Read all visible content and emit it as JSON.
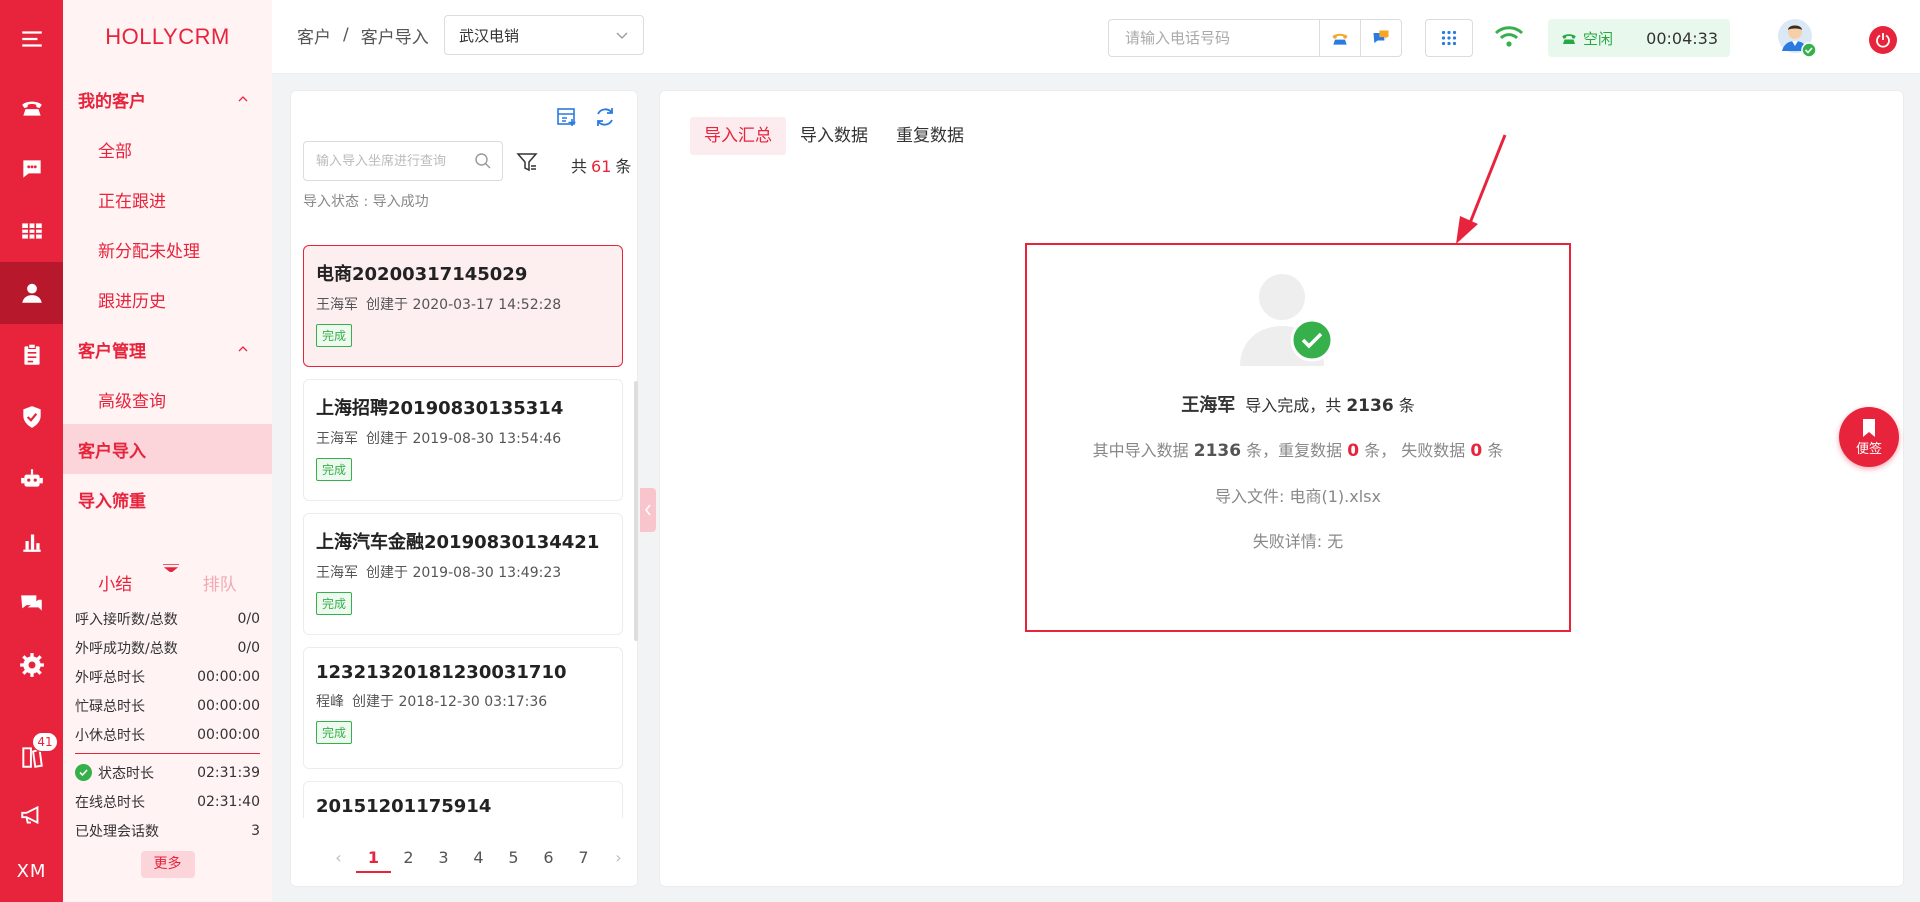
{
  "brand": "HOLLYCRM",
  "rail": {
    "badge": "41",
    "xm": "XM"
  },
  "sidebar": {
    "group1": "我的客户",
    "group1_items": [
      "全部",
      "正在跟进",
      "新分配未处理",
      "跟进历史"
    ],
    "group2": "客户管理",
    "group2_items": [
      "高级查询"
    ],
    "import": "客户导入",
    "filter": "导入筛重"
  },
  "stats": {
    "tab_summary": "小结",
    "tab_queue": "排队",
    "rows": [
      {
        "label": "呼入接听数/总数",
        "value": "0/0"
      },
      {
        "label": "外呼成功数/总数",
        "value": "0/0"
      },
      {
        "label": "外呼总时长",
        "value": "00:00:00"
      },
      {
        "label": "忙碌总时长",
        "value": "00:00:00"
      },
      {
        "label": "小休总时长",
        "value": "00:00:00"
      }
    ],
    "rows2": [
      {
        "label": "状态时长",
        "value": "02:31:39"
      },
      {
        "label": "在线总时长",
        "value": "02:31:40"
      },
      {
        "label": "已处理会话数",
        "value": "3"
      }
    ],
    "more": "更多"
  },
  "topbar": {
    "crumb1": "客户",
    "sep": "/",
    "crumb2": "客户导入",
    "select_value": "武汉电销",
    "phone_placeholder": "请输入电话号码",
    "status": "空闲",
    "timer": "00:04:33"
  },
  "list": {
    "search_placeholder": "输入导入坐席进行查询",
    "count_prefix": "共",
    "count": "61",
    "count_suffix": "条",
    "status_line": "导入状态 : 导入成功",
    "cards": [
      {
        "title": "电商20200317145029",
        "who": "王海军",
        "created": "创建于 2020-03-17 14:52:28",
        "tag": "完成"
      },
      {
        "title": "上海招聘20190830135314",
        "who": "王海军",
        "created": "创建于 2019-08-30 13:54:46",
        "tag": "完成"
      },
      {
        "title": "上海汽车金融20190830134421",
        "who": "王海军",
        "created": "创建于 2019-08-30 13:49:23",
        "tag": "完成"
      },
      {
        "title": "12321320181230031710",
        "who": "程峰",
        "created": "创建于 2018-12-30 03:17:36",
        "tag": "完成"
      },
      {
        "title": "20151201175914",
        "who": "",
        "created": "",
        "tag": ""
      }
    ],
    "pages": [
      "1",
      "2",
      "3",
      "4",
      "5",
      "6",
      "7"
    ]
  },
  "content": {
    "tabs": [
      "导入汇总",
      "导入数据",
      "重复数据"
    ],
    "summary": {
      "name": "王海军",
      "done_text": "导入完成，共",
      "total": "2136",
      "unit": "条",
      "l2_a": "其中导入数据",
      "l2_a_val": "2136",
      "l2_b": "条，重复数据",
      "l2_b_val": "0",
      "l2_c": "条， 失败数据",
      "l2_c_val": "0",
      "l2_d": "条",
      "file_line": "导入文件: 电商(1).xlsx",
      "fail_line": "失败详情:   无"
    }
  },
  "note_btn": "便签",
  "colors": {
    "brand": "#e8243c",
    "success": "#36b04a"
  }
}
